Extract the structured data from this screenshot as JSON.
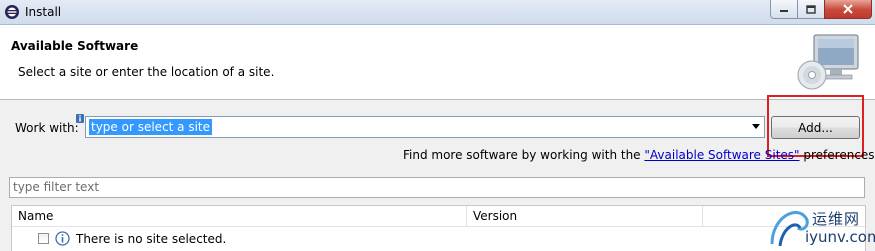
{
  "window": {
    "title": "Install"
  },
  "header": {
    "title": "Available Software",
    "description": "Select a site or enter the location of a site."
  },
  "work_with": {
    "label": "Work with:",
    "value": "type or select a site",
    "add_label": "Add..."
  },
  "find_more": {
    "prefix": "Find more software by working with the ",
    "link": "\"Available Software Sites\"",
    "suffix": " preferences."
  },
  "filter": {
    "placeholder": "type filter text"
  },
  "table": {
    "columns": [
      "Name",
      "Version",
      ""
    ],
    "rows": [
      {
        "name": "There is no site selected.",
        "version": "",
        "checked": false
      }
    ]
  },
  "watermark": {
    "cn": "运维网",
    "en": "iyunv.com"
  },
  "colors": {
    "highlight": "#3399ff",
    "link": "#0000cc",
    "annotation_box": "#e02020"
  },
  "icons": [
    "eclipse-app-icon",
    "minimize-icon",
    "maximize-icon",
    "close-icon",
    "install-monitor-icon",
    "info-decoration-icon",
    "dropdown-arrow-icon",
    "info-icon"
  ]
}
